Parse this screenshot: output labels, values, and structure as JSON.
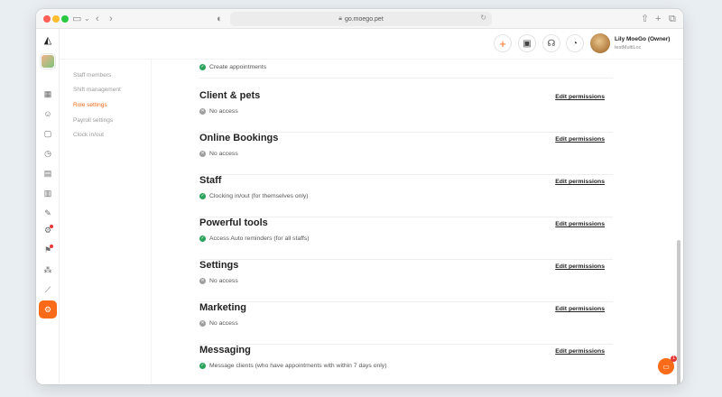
{
  "browser": {
    "url": "go.moego.pet"
  },
  "user": {
    "name": "Lily MoeGo (Owner)",
    "business": "testMultiLoc"
  },
  "subnav": {
    "items": [
      {
        "label": "Staff members"
      },
      {
        "label": "Shift management"
      },
      {
        "label": "Role settings"
      },
      {
        "label": "Payroll settings"
      },
      {
        "label": "Clock in/out"
      }
    ],
    "active_index": 2
  },
  "permissions": {
    "top_fragment": {
      "status": "allowed",
      "detail": "Create appointments"
    },
    "edit_label": "Edit permissions",
    "sections": [
      {
        "title": "Client & pets",
        "status": "denied",
        "detail": "No access"
      },
      {
        "title": "Online Bookings",
        "status": "denied",
        "detail": "No access"
      },
      {
        "title": "Staff",
        "status": "allowed",
        "detail": "Clocking in/out (for themselves only)"
      },
      {
        "title": "Powerful tools",
        "status": "allowed",
        "detail": "Access Auto reminders  (for all staffs)"
      },
      {
        "title": "Settings",
        "status": "denied",
        "detail": "No access"
      },
      {
        "title": "Marketing",
        "status": "denied",
        "detail": "No access"
      },
      {
        "title": "Messaging",
        "status": "allowed",
        "detail": "Message clients (who have appointments with within 7 days only)"
      }
    ]
  },
  "chat": {
    "badge_count": "1"
  },
  "colors": {
    "accent": "#f96b18",
    "allowed": "#29a35a",
    "denied": "#9e9e9e"
  }
}
